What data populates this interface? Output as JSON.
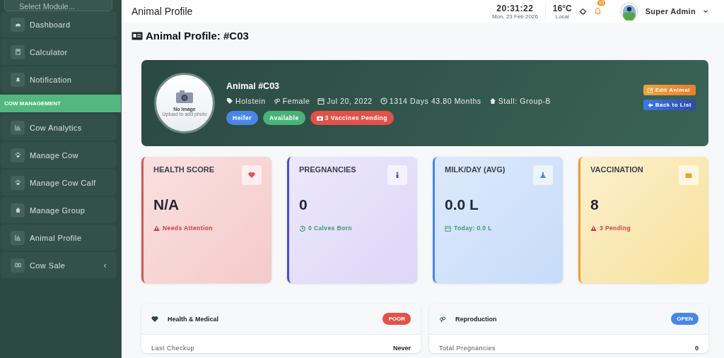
{
  "sidebar": {
    "module_select": {
      "placeholder": "Select Module..."
    },
    "items": [
      {
        "label": "Dashboard"
      },
      {
        "label": "Calculator"
      },
      {
        "label": "Notification"
      }
    ],
    "section": "COW MANAGEMENT",
    "section_items": [
      {
        "label": "Cow Analytics"
      },
      {
        "label": "Manage Cow"
      },
      {
        "label": "Manage Cow Calf"
      },
      {
        "label": "Manage Group"
      },
      {
        "label": "Animal Profile"
      },
      {
        "label": "Cow Sale",
        "caret": "‹"
      }
    ]
  },
  "topbar": {
    "title": "Animal Profile",
    "time": "20:31:22",
    "date": "Mon, 23 Feb 2026",
    "temperature": "16°C",
    "temperature_label": "Local",
    "notification_count": "10",
    "user": "Super Admin"
  },
  "page_title": "Animal Profile: #C03",
  "profile": {
    "photo_label": "No Image",
    "photo_hint": "Upload to add photo",
    "name": "Animal #C03",
    "facts": [
      "Holstein",
      "Female",
      "Jul 20, 2022",
      "1314 Days 43.80 Months",
      "Stall: Group-B"
    ],
    "badges": [
      {
        "text": "Heifer",
        "color": "#4a86e8",
        "kind": "plain"
      },
      {
        "text": "Available",
        "color": "#48b27a",
        "kind": "plain"
      },
      {
        "text": "3 Vaccines Pending",
        "color": "#e0524a",
        "kind": "vaccine"
      }
    ],
    "buttons": [
      {
        "label": "Edit Animal",
        "kind": "edit"
      },
      {
        "label": "Back to List",
        "kind": "back"
      }
    ]
  },
  "stats": [
    {
      "title": "HEALTH SCORE",
      "value": "N/A",
      "note": "Needs Attention",
      "color": "#e05252",
      "kind": "warning"
    },
    {
      "title": "PREGNANCIES",
      "value": "0",
      "note": "0 Calves Born",
      "color": "#4b4fc4",
      "kind": "history"
    },
    {
      "title": "MILK/DAY (AVG)",
      "value": "0.0 L",
      "note": "Today: 0.0 L",
      "color": "#4a86e8",
      "kind": "calendar"
    },
    {
      "title": "VACCINATION",
      "value": "8",
      "note": "3 Pending",
      "color": "#ef9f2f",
      "kind": "warning"
    }
  ],
  "panels": [
    {
      "title": "Health & Medical",
      "status": "POOR",
      "color": "#e0524a",
      "row_label": "Last Checkup",
      "row_value": "Never"
    },
    {
      "title": "Reproduction",
      "status": "OPEN",
      "color": "#4a86e8",
      "row_label": "Total Pregnancies",
      "row_value": "0"
    }
  ]
}
